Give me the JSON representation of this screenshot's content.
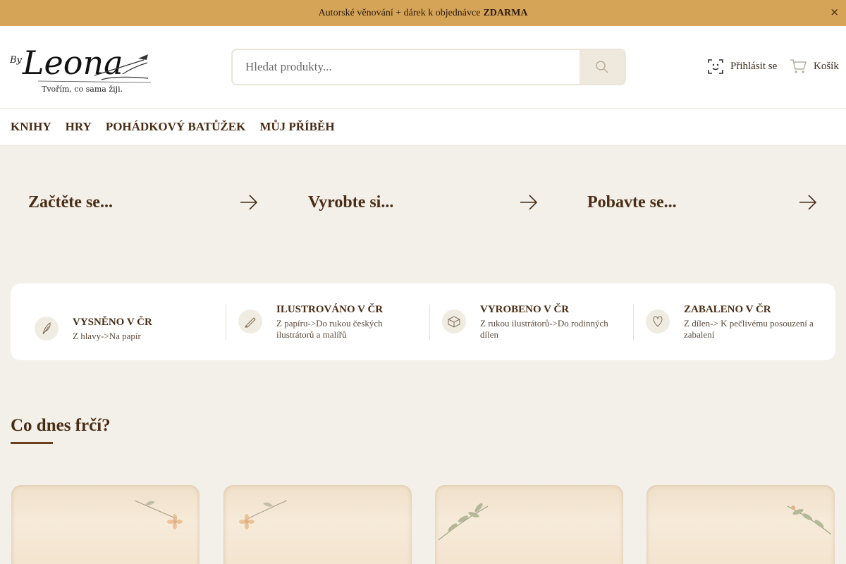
{
  "announcement": {
    "text": "Autorské věnování + dárek k objednávce",
    "bold": "ZDARMA",
    "close": "×"
  },
  "logo": {
    "prefix": "By",
    "name": "Leona",
    "tagline": "Tvořím, co sama žiji."
  },
  "search": {
    "placeholder": "Hledat produkty...",
    "icon": "search-icon"
  },
  "header_links": {
    "login": "Přihlásit se",
    "cart": "Košík"
  },
  "nav": [
    "KNIHY",
    "HRY",
    "POHÁDKOVÝ BATŮŽEK",
    "MŮJ PŘÍBĚH"
  ],
  "tiles": [
    "Začtěte se...",
    "Vyrobte si...",
    "Pobavte se..."
  ],
  "features": [
    {
      "title": "VYSNĚNO V ČR",
      "desc": "Z hlavy->Na papír",
      "icon": "feather-icon"
    },
    {
      "title": "ILUSTROVÁNO V ČR",
      "desc": "Z papíru->Do rukou českých ilustrátorů a malířů",
      "icon": "pencil-icon"
    },
    {
      "title": "VYROBENO V ČR",
      "desc": "Z rukou ilustrátorů->Do rodinných dílen",
      "icon": "box-icon"
    },
    {
      "title": "ZABALENO V ČR",
      "desc": "Z dílen-> K pečlivému posouzení a zabalení",
      "icon": "heart-icon"
    }
  ],
  "section": {
    "title": "Co dnes frčí?"
  },
  "colors": {
    "topbar": "#d6a457",
    "primary_text": "#4a2d14",
    "background": "#f3f0e9"
  }
}
